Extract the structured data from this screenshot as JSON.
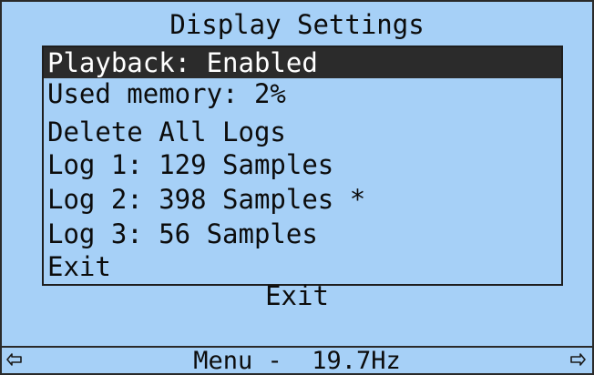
{
  "screen": {
    "title": "Display Settings",
    "menu": {
      "items": [
        {
          "label": "Playback: Enabled",
          "selected": true
        },
        {
          "label": "Used memory: 2%",
          "selected": false
        },
        {
          "label": "Delete All Logs",
          "selected": false
        },
        {
          "label": "Log 1: 129 Samples",
          "selected": false
        },
        {
          "label": "Log 2: 398 Samples *",
          "selected": false
        },
        {
          "label": "Log 3: 56 Samples",
          "selected": false
        },
        {
          "label": "Exit",
          "selected": false
        }
      ]
    },
    "footer_exit": "Exit",
    "status": {
      "text": "Menu -  19.7Hz",
      "left_icon": "arrow-left-icon",
      "right_icon": "arrow-right-icon"
    }
  },
  "colors": {
    "background": "#a6d0f7",
    "highlight": "#2b2b2b",
    "highlight_text": "#ffffff",
    "text": "#0c0c0c"
  }
}
